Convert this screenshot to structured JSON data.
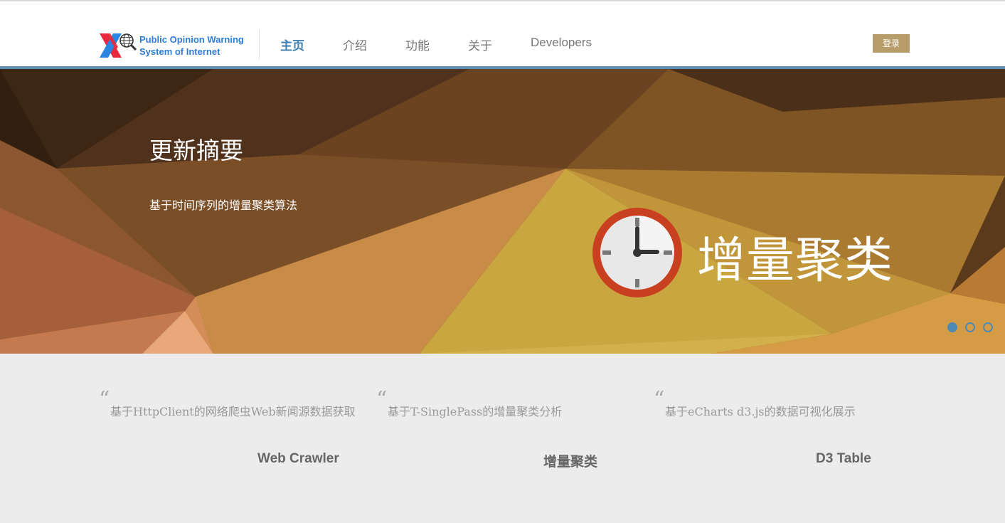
{
  "header": {
    "logo_line1": "Public Opinion Warning",
    "logo_line2": "System of Internet",
    "nav": [
      "主页",
      "介绍",
      "功能",
      "关于",
      "Developers"
    ],
    "active_nav": "主页",
    "login_label": "登录"
  },
  "hero": {
    "title": "更新摘要",
    "subtitle": "基于时间序列的增量聚类算法",
    "big_text": "增量聚类",
    "icon": "clock-icon",
    "slide_count": 3,
    "active_slide": 1
  },
  "features": [
    {
      "text": "基于HttpClient的网络爬虫Web新闻源数据获取",
      "title": "Web Crawler"
    },
    {
      "text": "基于T-SinglePass的增量聚类分析",
      "title": "增量聚类"
    },
    {
      "text": "基于eCharts  d3.js的数据可视化展示",
      "title": "D3 Table"
    }
  ],
  "colors": {
    "accent_blue": "#5b8fb4",
    "nav_active": "#3d7fb2",
    "login_bg": "#b89d6c",
    "hero_brown": "#6b4423"
  }
}
